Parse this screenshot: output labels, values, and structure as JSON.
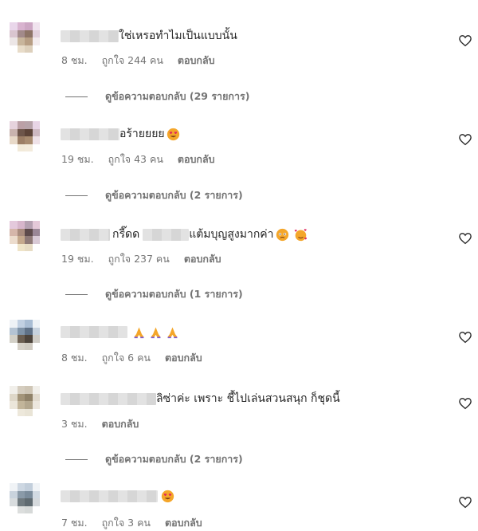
{
  "comments": [
    {
      "text": "ใช่เหรอทำไมเป็นแบบนั้น",
      "time": "8 ชม.",
      "likes": "ถูกใจ 244 คน",
      "reply": "ตอบกลับ",
      "view_replies": "ดูข้อความตอบกลับ (29 รายการ)"
    },
    {
      "text": "อร้ายยยย",
      "time": "19 ชม.",
      "likes": "ถูกใจ 43 คน",
      "reply": "ตอบกลับ",
      "view_replies": "ดูข้อความตอบกลับ (2 รายการ)"
    },
    {
      "text_a": "กรี๊ดด",
      "text_b": "แต้มบุญสูงมากค่า",
      "time": "19 ชม.",
      "likes": "ถูกใจ 237 คน",
      "reply": "ตอบกลับ",
      "view_replies": "ดูข้อความตอบกลับ (1 รายการ)"
    },
    {
      "text": "",
      "time": "8 ชม.",
      "likes": "ถูกใจ 6 คน",
      "reply": "ตอบกลับ"
    },
    {
      "text": "ลิซ่าค่ะ เพราะ ชี้ไปเล่นสวนสนุก ก็ชุดนี้",
      "time": "3 ชม.",
      "reply": "ตอบกลับ",
      "view_replies": "ดูข้อความตอบกลับ (2 รายการ)"
    },
    {
      "text": "",
      "time": "7 ชม.",
      "likes": "ถูกใจ 3 คน",
      "reply": "ตอบกลับ"
    }
  ],
  "icons": {
    "like": "heart-outline-icon",
    "emoji_heart_eyes": "heart-eyes-emoji",
    "emoji_pray": "praying-hands-emoji",
    "emoji_woozy": "woozy-face-emoji",
    "emoji_kiss": "face-hearts-emoji"
  },
  "colors": {
    "secondary_text": "#737373",
    "primary_text": "#262626",
    "emoji_face": "#f4a62a",
    "emoji_heart": "#e0245e"
  }
}
